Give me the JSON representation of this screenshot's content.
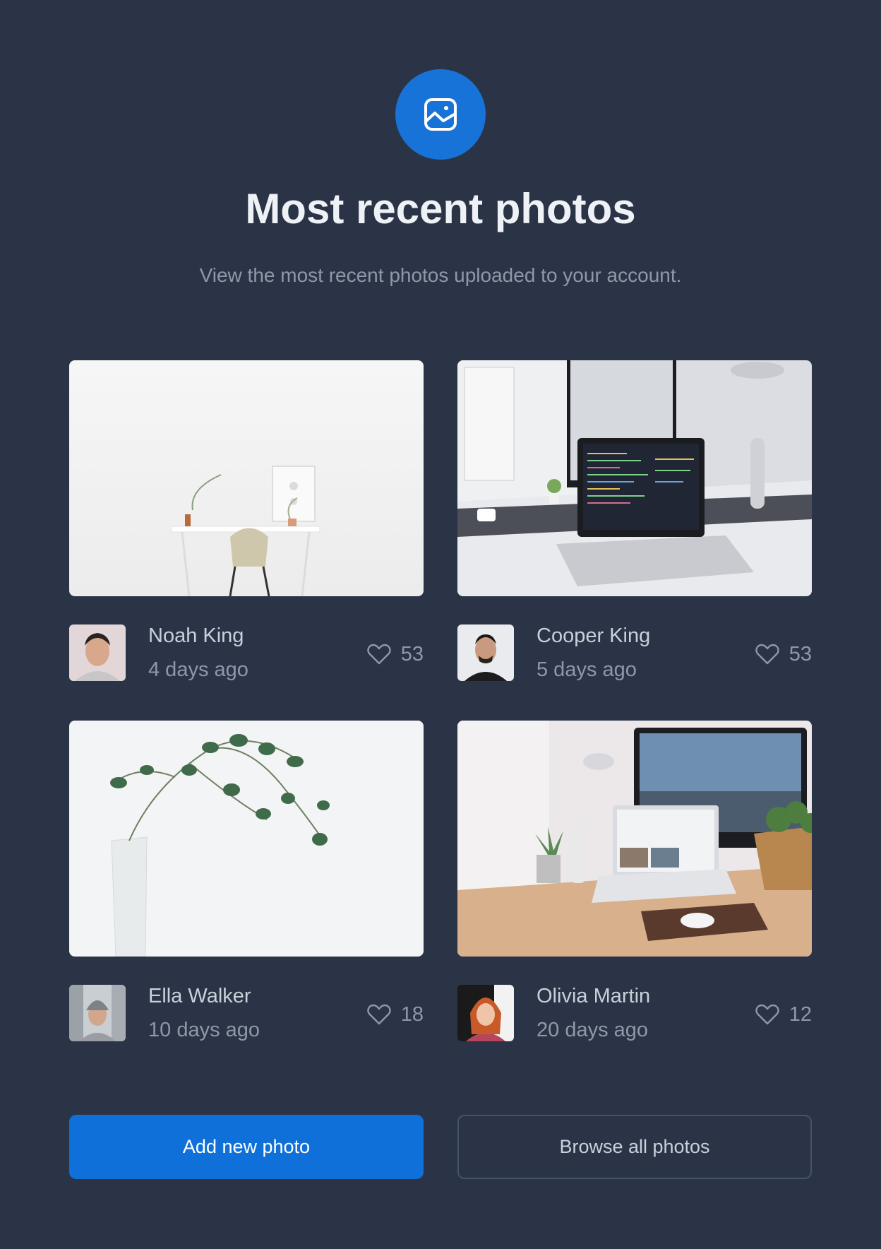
{
  "header": {
    "icon": "image-icon",
    "title": "Most recent photos",
    "subtitle": "View the most recent photos uploaded to your account."
  },
  "photos": [
    {
      "author": "Noah King",
      "time": "4 days ago",
      "likes": "53",
      "scene": "white desk with chair"
    },
    {
      "author": "Cooper King",
      "time": "5 days ago",
      "likes": "53",
      "scene": "laptop with code on desk"
    },
    {
      "author": "Ella Walker",
      "time": "10 days ago",
      "likes": "18",
      "scene": "eucalyptus branch in vase"
    },
    {
      "author": "Olivia Martin",
      "time": "20 days ago",
      "likes": "12",
      "scene": "wooden desk with laptop and monitor"
    }
  ],
  "actions": {
    "primary_label": "Add new photo",
    "secondary_label": "Browse all photos"
  },
  "colors": {
    "background": "#2a3446",
    "accent": "#1773d8",
    "title": "#eef1f5",
    "muted": "#8e98a8"
  }
}
